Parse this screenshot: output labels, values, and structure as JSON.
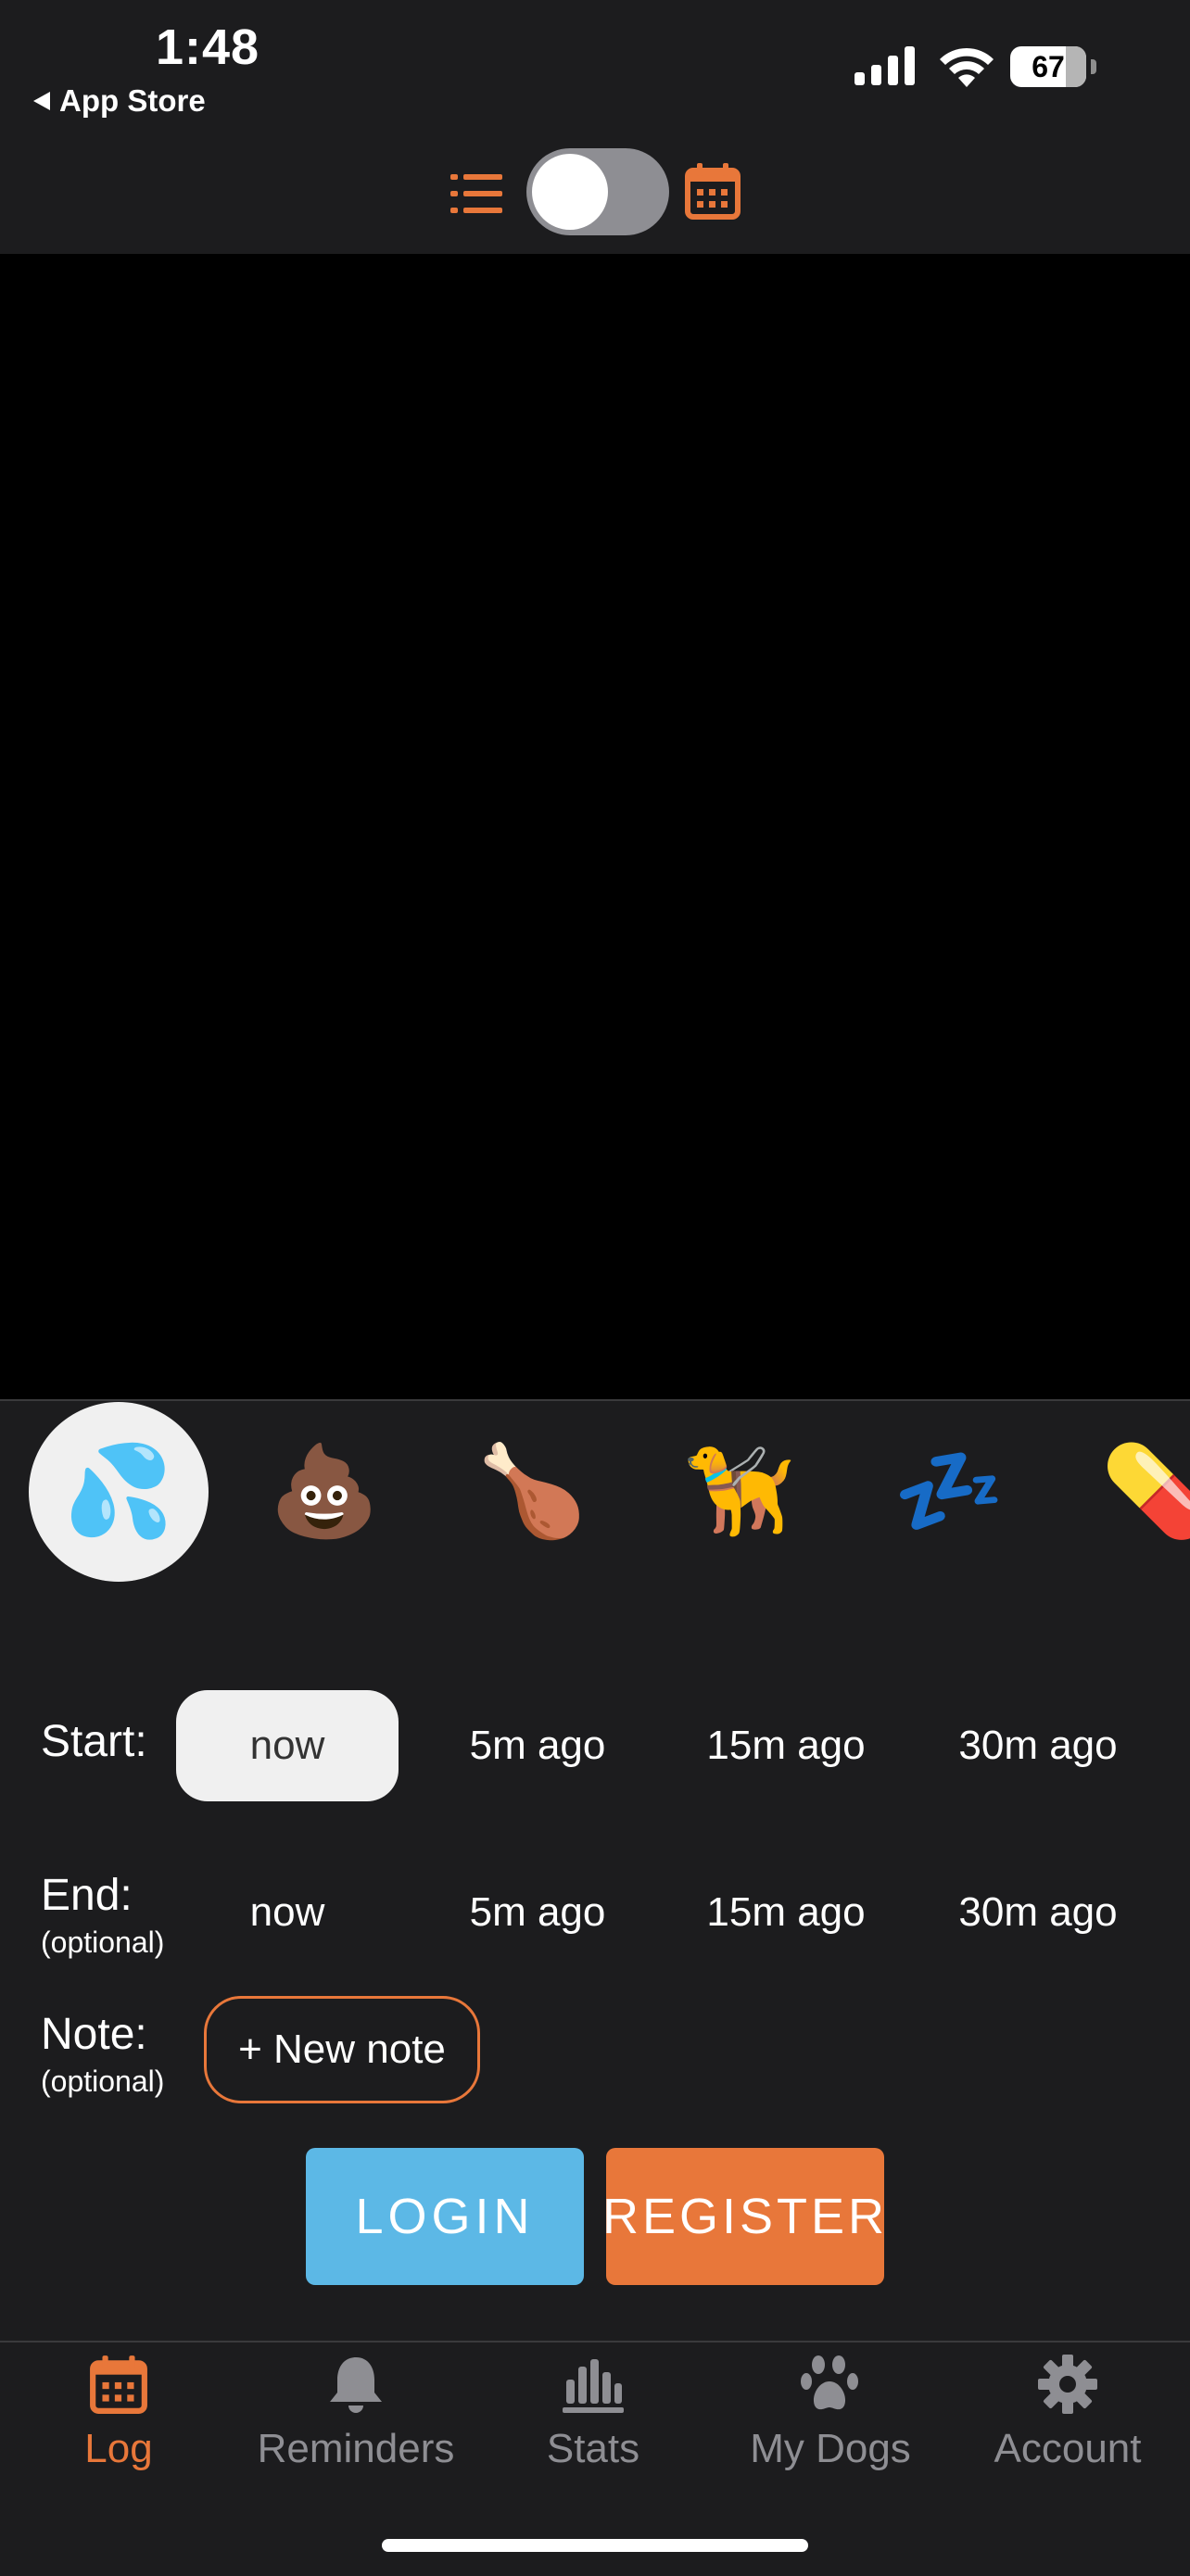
{
  "status_bar": {
    "time": "1:48",
    "back_label": "App Store",
    "battery": "67"
  },
  "view_toggle": {
    "left_icon": "list-icon",
    "right_icon": "calendar-icon",
    "state": "off"
  },
  "categories": [
    {
      "name": "pee",
      "emoji": "💦",
      "selected": true
    },
    {
      "name": "poop",
      "emoji": "💩",
      "selected": false
    },
    {
      "name": "food",
      "emoji": "🍗",
      "selected": false
    },
    {
      "name": "walk",
      "emoji": "🦮",
      "selected": false
    },
    {
      "name": "sleep",
      "emoji": "💤",
      "selected": false
    },
    {
      "name": "medicine",
      "emoji": "💊",
      "selected": false
    }
  ],
  "start": {
    "label": "Start:",
    "options": [
      "now",
      "5m ago",
      "15m ago",
      "30m ago"
    ],
    "selected": "now"
  },
  "end": {
    "label": "End:",
    "sublabel": "(optional)",
    "options": [
      "now",
      "5m ago",
      "15m ago",
      "30m ago"
    ]
  },
  "note": {
    "label": "Note:",
    "sublabel": "(optional)",
    "button": "+ New note"
  },
  "auth": {
    "login": "LOGIN",
    "register": "REGISTER"
  },
  "tabs": [
    {
      "label": "Log",
      "icon": "calendar-icon",
      "active": true
    },
    {
      "label": "Reminders",
      "icon": "bell-icon",
      "active": false
    },
    {
      "label": "Stats",
      "icon": "bar-chart-icon",
      "active": false
    },
    {
      "label": "My Dogs",
      "icon": "paw-icon",
      "active": false
    },
    {
      "label": "Account",
      "icon": "gear-icon",
      "active": false
    }
  ],
  "colors": {
    "accent": "#e8773a",
    "login": "#5cb8e6",
    "background": "#1c1c1e",
    "content": "#000000"
  }
}
